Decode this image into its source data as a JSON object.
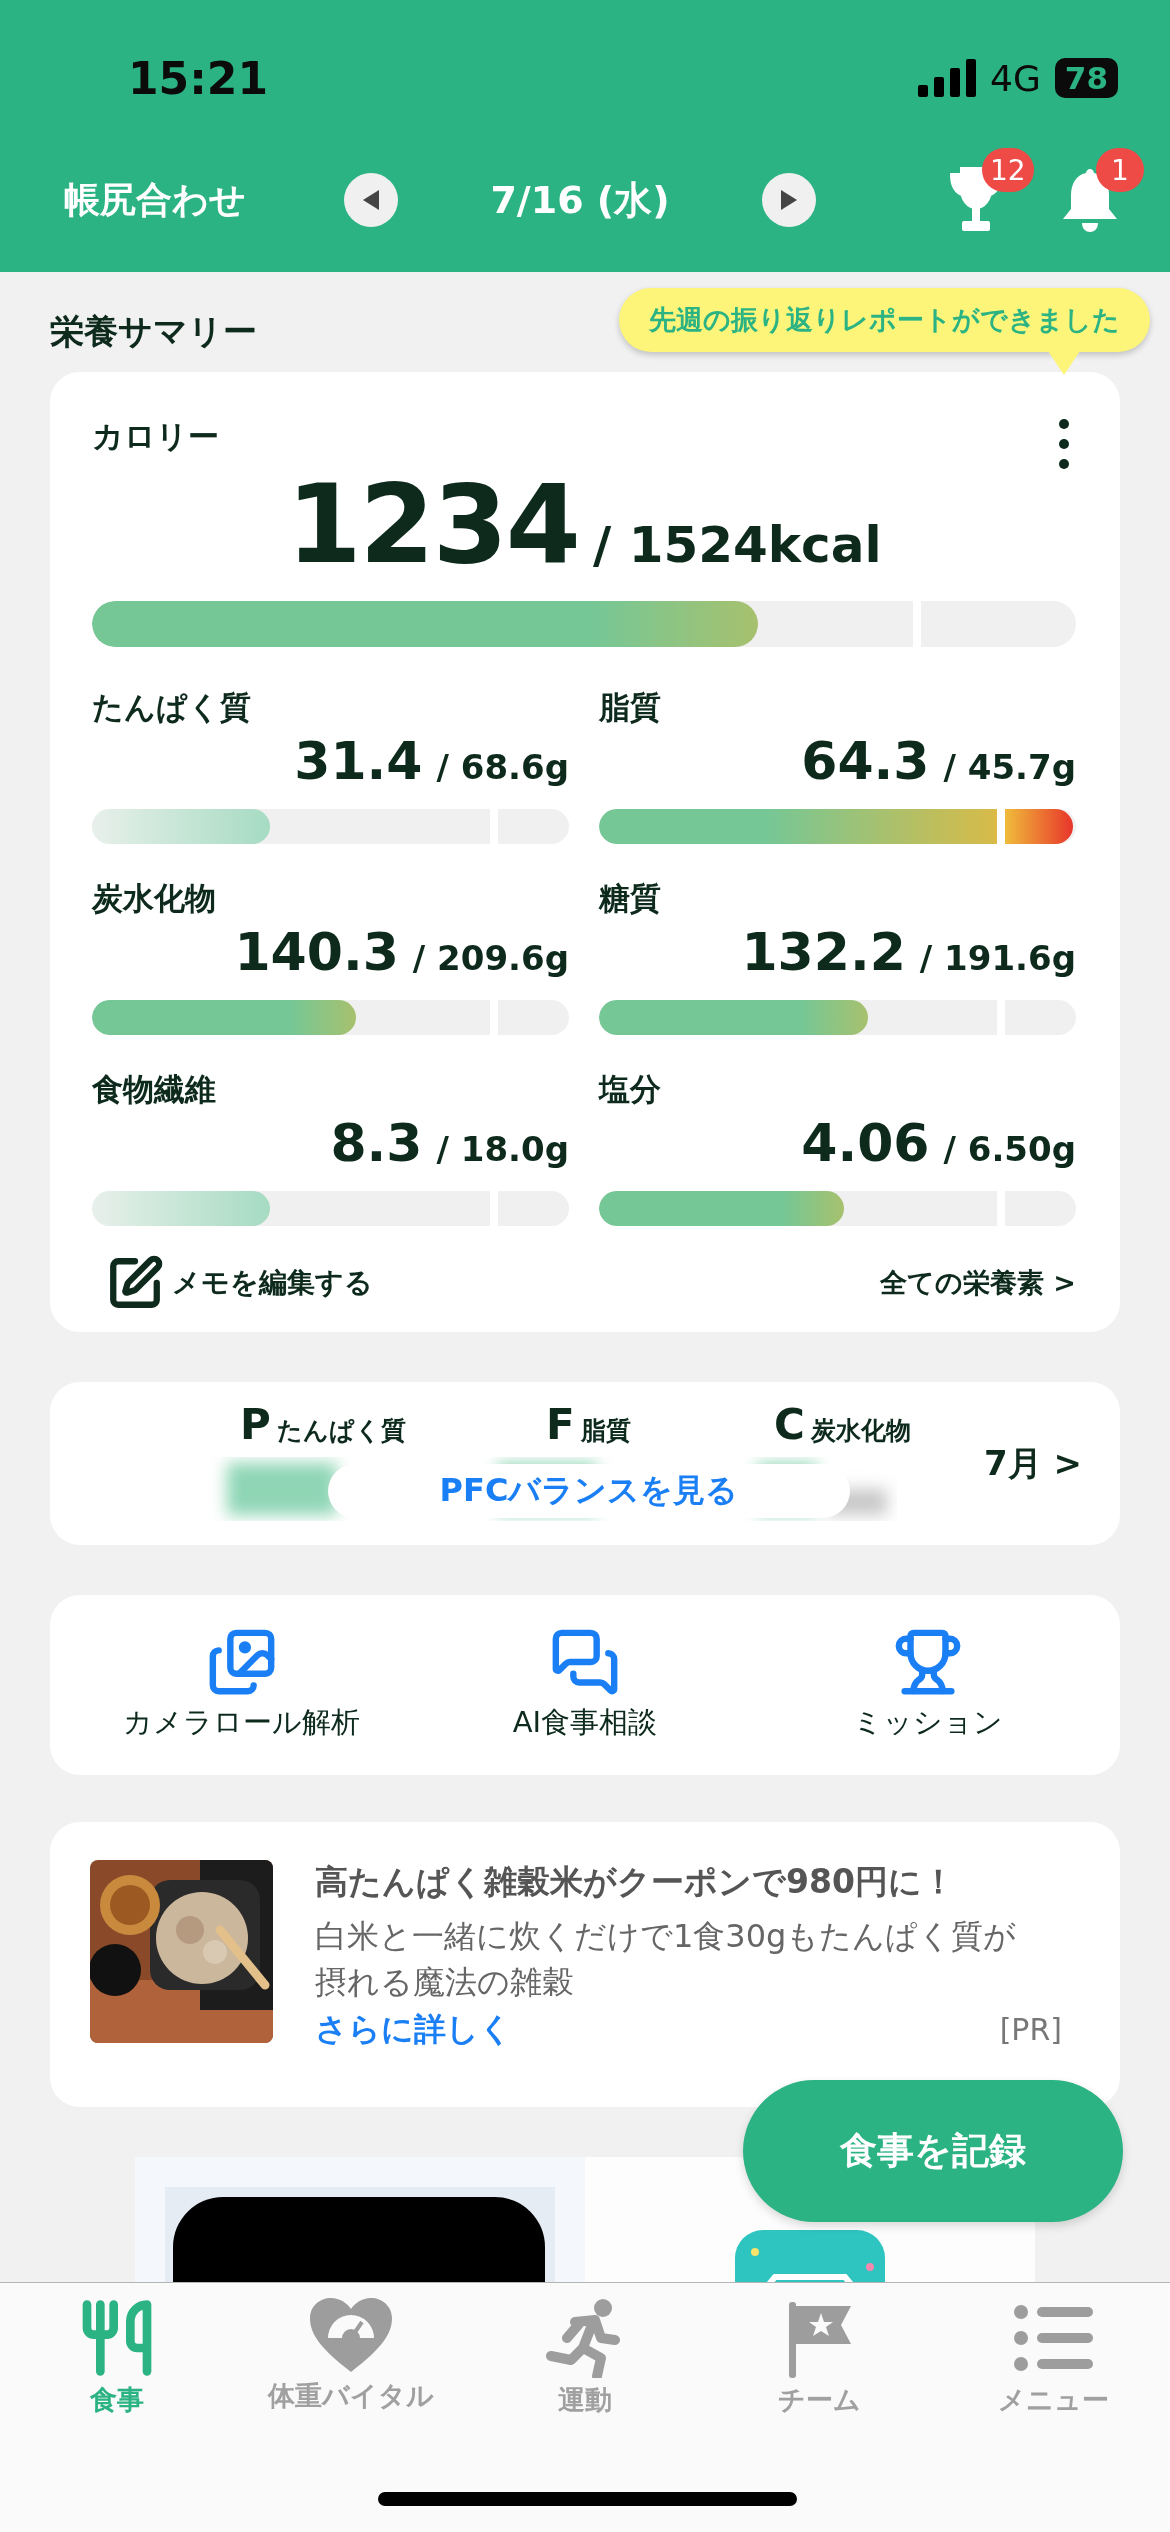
{
  "status_bar": {
    "time": "15:21",
    "network": "4G",
    "battery": "78"
  },
  "header": {
    "title": "帳尻合わせ",
    "date": "7/16 (水)",
    "trophy_badge": "12",
    "bell_badge": "1"
  },
  "summary": {
    "title": "栄養サマリー",
    "tooltip": "先週の振り返りレポートができました",
    "calorie": {
      "label": "カロリー",
      "value": "1234",
      "target": "/ 1524kcal",
      "level": 0.68,
      "kind": "good"
    },
    "nutrients": [
      {
        "label": "たんぱく質",
        "value": "31.4",
        "target": "/ 68.6g",
        "level": 0.38,
        "kind": "low"
      },
      {
        "label": "脂質",
        "value": "64.3",
        "target": "/ 45.7g",
        "level": 1,
        "kind": "over"
      },
      {
        "label": "炭水化物",
        "value": "140.3",
        "target": "/ 209.6g",
        "level": 0.56,
        "kind": "good"
      },
      {
        "label": "糖質",
        "value": "132.2",
        "target": "/ 191.6g",
        "level": 0.57,
        "kind": "good"
      },
      {
        "label": "食物繊維",
        "value": "8.3",
        "target": "/ 18.0g",
        "level": 0.38,
        "kind": "low"
      },
      {
        "label": "塩分",
        "value": "4.06",
        "target": "/ 6.50g",
        "level": 0.52,
        "kind": "good"
      }
    ],
    "memo_link": "メモを編集する",
    "all_link": "全ての栄養素 >"
  },
  "pfc": {
    "items": [
      {
        "letter": "P",
        "label": "たんぱく質"
      },
      {
        "letter": "F",
        "label": "脂質"
      },
      {
        "letter": "C",
        "label": "炭水化物"
      }
    ],
    "button": "PFCバランスを見る",
    "month_link": "7月 >"
  },
  "shortcuts": [
    {
      "kind": "photos",
      "label": "カメラロール解析"
    },
    {
      "kind": "chat",
      "label": "AI食事相談"
    },
    {
      "kind": "trophy",
      "label": "ミッション"
    }
  ],
  "ad": {
    "title": "高たんぱく雑穀米がクーポンで980円に！",
    "body": "白米と一緒に炊くだけで1食30gもたんぱく質が摂れる魔法の雑穀",
    "link": "さらに詳しく",
    "tag": "[PR]"
  },
  "fab": "食事を記録",
  "tab_bar": [
    {
      "kind": "meal",
      "label": "食事",
      "selected": true
    },
    {
      "kind": "vital",
      "label": "体重バイタル",
      "selected": false
    },
    {
      "kind": "exercise",
      "label": "運動",
      "selected": false
    },
    {
      "kind": "team",
      "label": "チーム",
      "selected": false
    },
    {
      "kind": "menu",
      "label": "メニュー",
      "selected": false
    }
  ]
}
